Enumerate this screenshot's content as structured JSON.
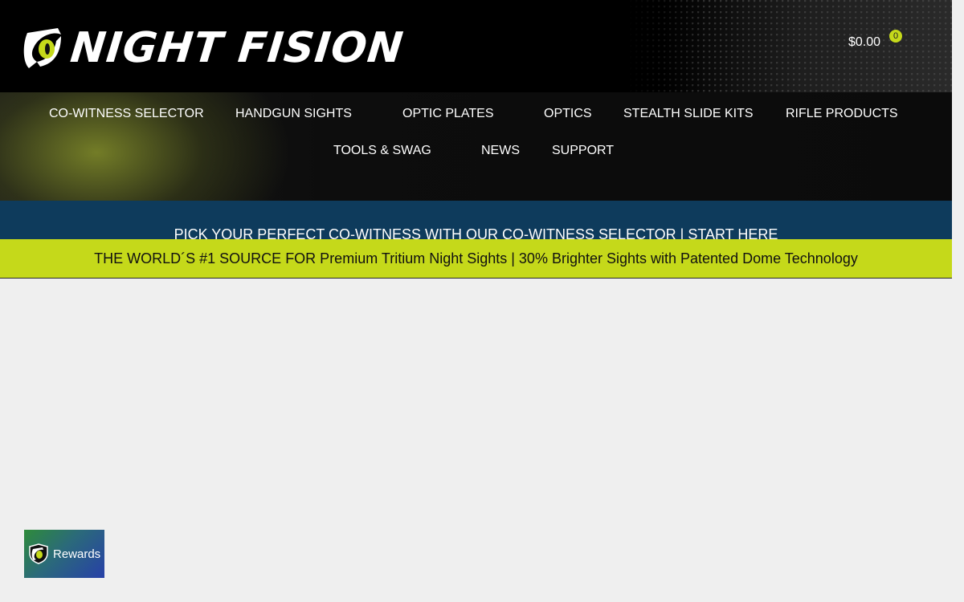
{
  "brand": {
    "name": "NIGHT FISION",
    "accent_color": "#c5d91a",
    "logo_icon": "night-fision-eye-logo-icon"
  },
  "cart": {
    "total": "$0.00",
    "count": "0"
  },
  "nav": {
    "items": [
      {
        "label": "CO-WITNESS SELECTOR"
      },
      {
        "label": "HANDGUN SIGHTS"
      },
      {
        "label": "OPTIC PLATES"
      },
      {
        "label": "OPTICS"
      },
      {
        "label": "STEALTH SLIDE KITS"
      },
      {
        "label": "RIFLE PRODUCTS"
      },
      {
        "label": "TOOLS & SWAG"
      },
      {
        "label": "NEWS"
      },
      {
        "label": "SUPPORT"
      }
    ]
  },
  "promo": {
    "text": "PICK YOUR PERFECT CO-WITNESS WITH OUR CO-WITNESS SELECTOR | START HERE",
    "bg_color": "#0e3b5c"
  },
  "tagline": {
    "text": "THE WORLD´S #1 SOURCE FOR Premium Tritium Night Sights | 30% Brighter Sights with Patented Dome Technology"
  },
  "rewards": {
    "label": "Rewards",
    "icon": "shield-eye-icon"
  }
}
